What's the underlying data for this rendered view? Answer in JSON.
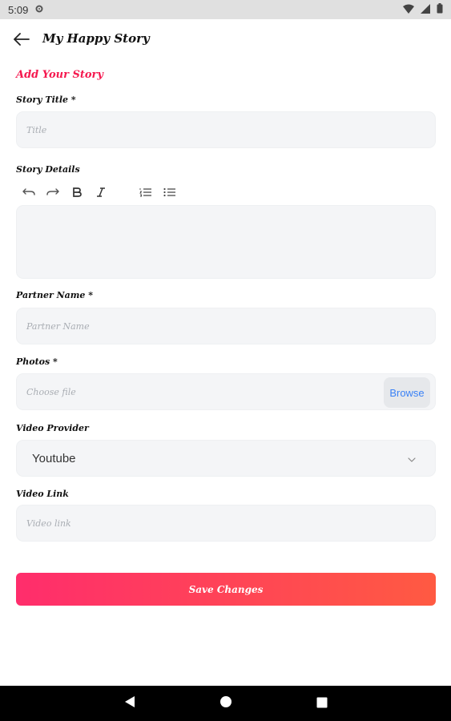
{
  "status_bar": {
    "time": "5:09"
  },
  "app_bar": {
    "title": "My Happy Story"
  },
  "form": {
    "section_title": "Add Your Story",
    "story_title": {
      "label": "Story Title *",
      "placeholder": "Title"
    },
    "story_details": {
      "label": "Story Details"
    },
    "partner_name": {
      "label": "Partner Name *",
      "placeholder": "Partner Name"
    },
    "photos": {
      "label": "Photos *",
      "placeholder": "Choose file",
      "browse_label": "Browse"
    },
    "video_provider": {
      "label": "Video Provider",
      "value": "Youtube"
    },
    "video_link": {
      "label": "Video Link",
      "placeholder": "Video link"
    },
    "save_label": "Save Changes"
  },
  "toolbar_icons": [
    "undo-icon",
    "redo-icon",
    "bold-icon",
    "italic-icon",
    "ordered-list-icon",
    "bullet-list-icon"
  ],
  "colors": {
    "accent": "#f5194f",
    "gradient_start": "#ff2d6c",
    "gradient_end": "#ff5a42",
    "link": "#3b82f6"
  }
}
